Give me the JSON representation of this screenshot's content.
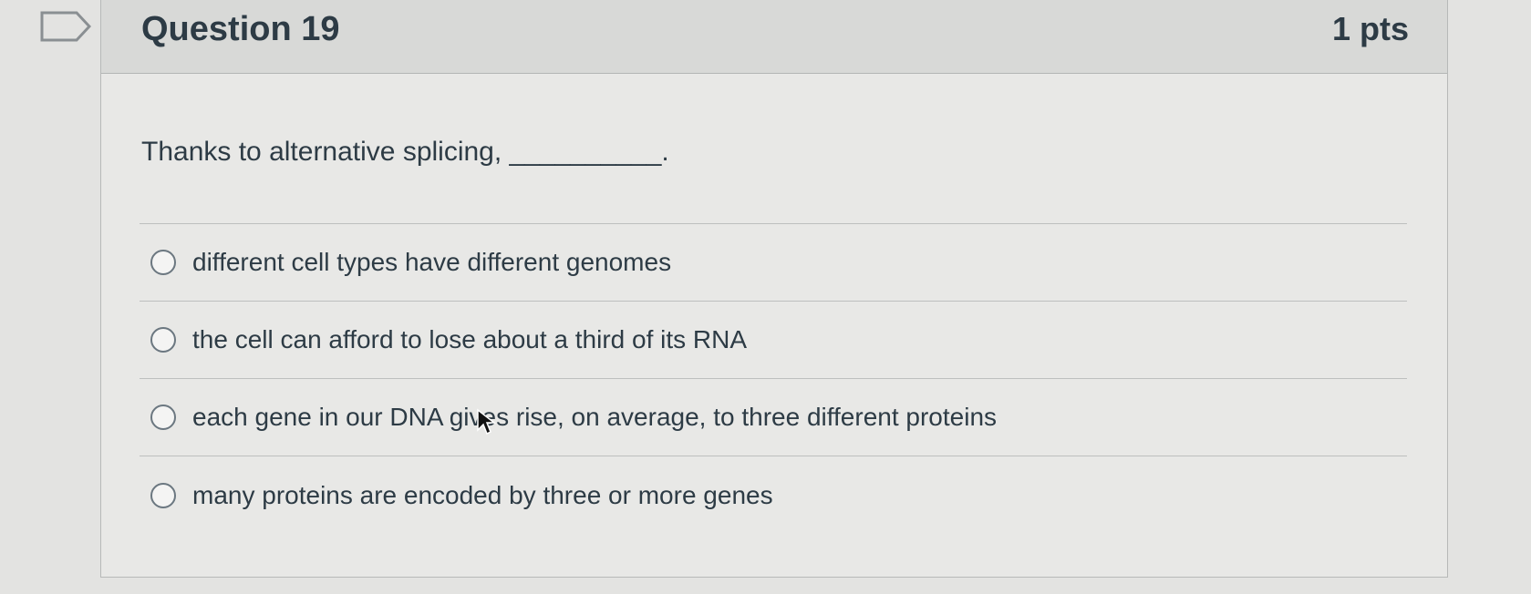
{
  "question": {
    "title": "Question 19",
    "points": "1 pts",
    "prompt": "Thanks to alternative splicing, __________."
  },
  "answers": [
    {
      "label": "different cell types have different genomes",
      "selected": false
    },
    {
      "label": "the cell can afford to lose about a third of its RNA",
      "selected": false
    },
    {
      "label": "each gene in our DNA gives rise, on average, to three different proteins",
      "selected": false
    },
    {
      "label": "many proteins are encoded by three or more genes",
      "selected": false
    }
  ],
  "icons": {
    "flag": "flag-question-icon",
    "cursor": "mouse-cursor-icon"
  }
}
